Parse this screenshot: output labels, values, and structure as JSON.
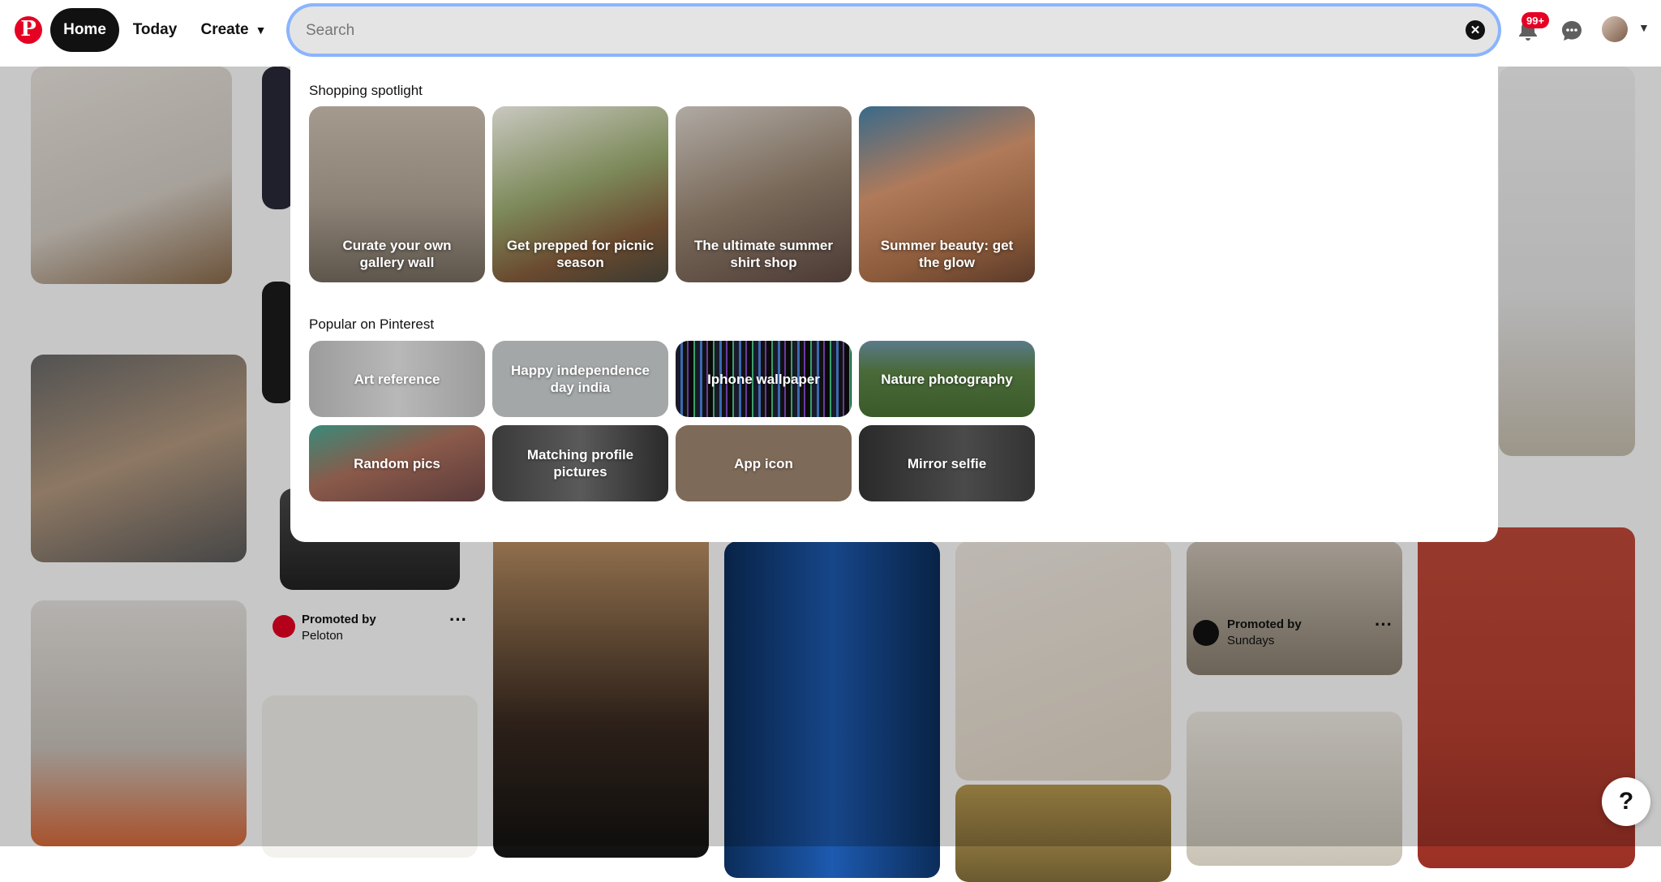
{
  "nav": {
    "home_label": "Home",
    "today_label": "Today",
    "create_label": "Create",
    "notifications_badge": "99+"
  },
  "search": {
    "placeholder": "Search",
    "value": ""
  },
  "dropdown": {
    "shopping_title": "Shopping spotlight",
    "shopping": [
      {
        "label": "Curate your own gallery wall"
      },
      {
        "label": "Get prepped for picnic season"
      },
      {
        "label": "The ultimate summer shirt shop"
      },
      {
        "label": "Summer beauty: get the glow"
      }
    ],
    "popular_title": "Popular on Pinterest",
    "popular": [
      {
        "label": "Art reference"
      },
      {
        "label": "Happy independence day india"
      },
      {
        "label": "Iphone wallpaper"
      },
      {
        "label": "Nature photography"
      },
      {
        "label": "Random pics"
      },
      {
        "label": "Matching profile pictures"
      },
      {
        "label": "App icon"
      },
      {
        "label": "Mirror selfie"
      }
    ]
  },
  "feed": {
    "promo1": {
      "title": "Promoted by",
      "by": "Peloton"
    },
    "promo2": {
      "title": "Promoted by",
      "by": "Sundays"
    }
  },
  "help_label": "?"
}
